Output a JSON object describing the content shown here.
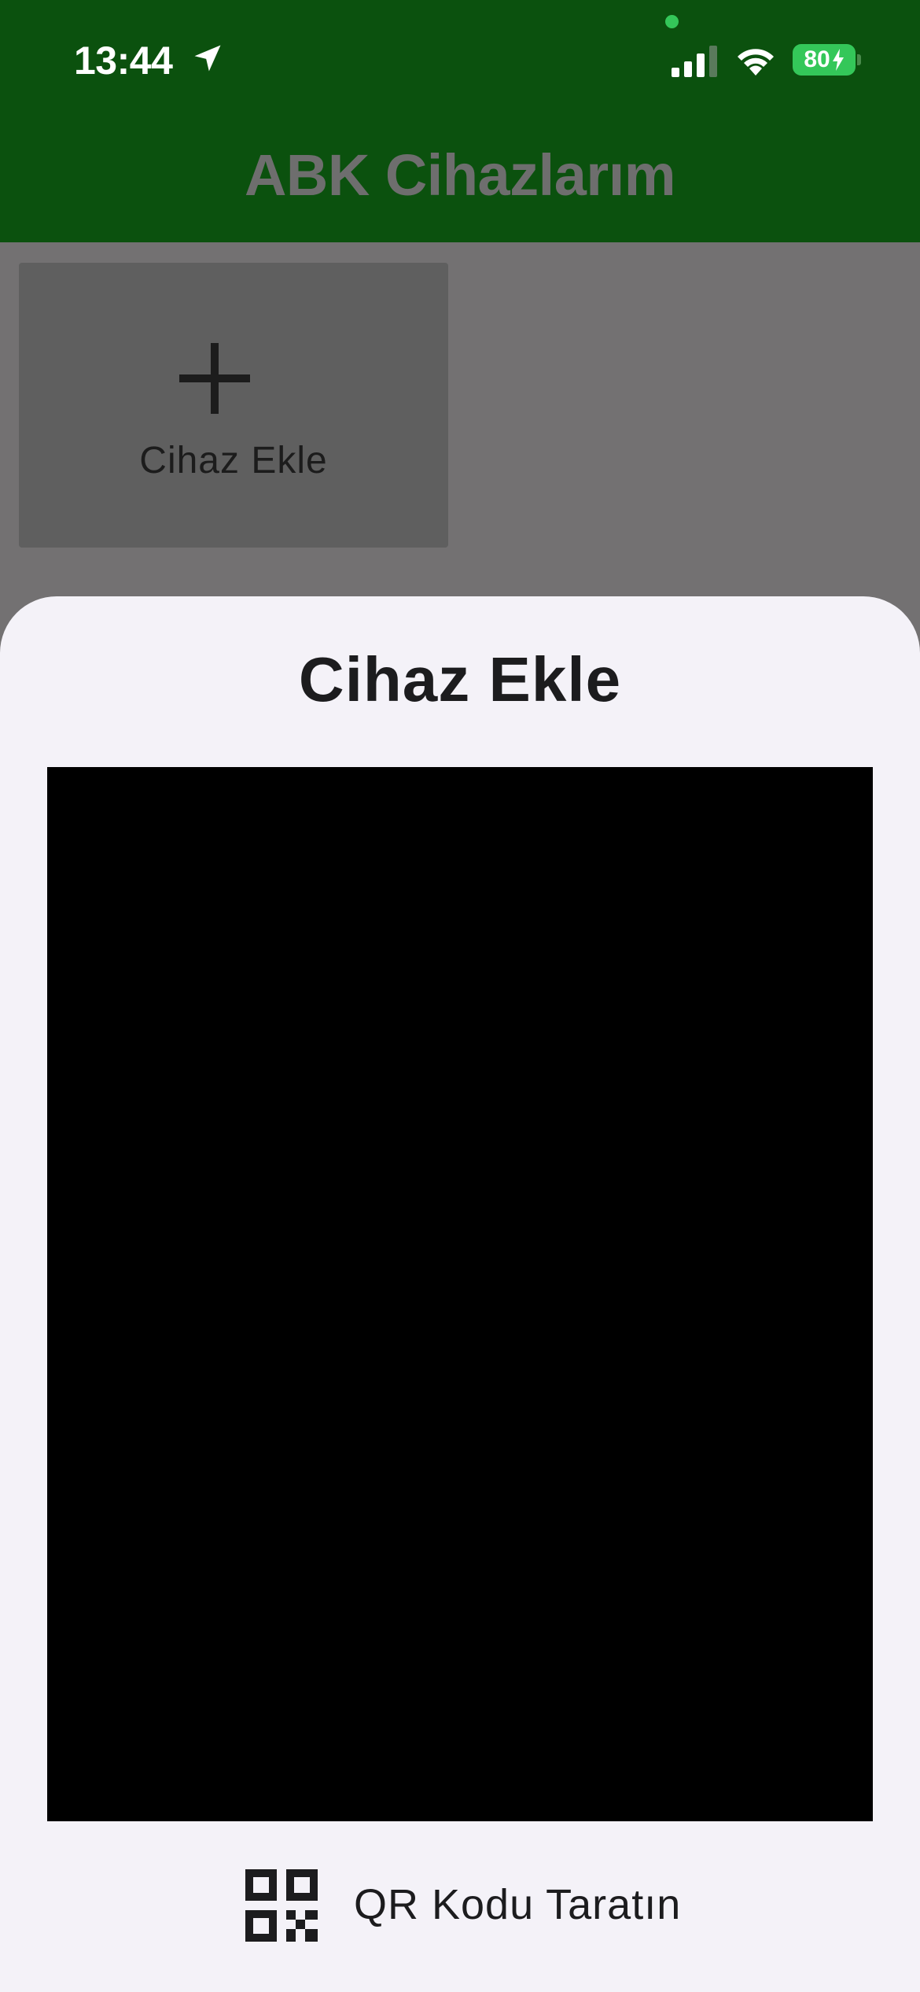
{
  "status_bar": {
    "time": "13:44",
    "battery_level": "80",
    "icons": [
      "location-arrow-icon",
      "cellular-signal-icon",
      "wifi-icon",
      "battery-charging-icon"
    ]
  },
  "header": {
    "title": "ABK Cihazlarım",
    "background_color": "#0b510e"
  },
  "device_grid": {
    "add_tile": {
      "icon": "plus-icon",
      "label": "Cihaz Ekle"
    }
  },
  "sheet": {
    "title": "Cihaz Ekle",
    "scan_button": {
      "icon": "qr-code-icon",
      "label": "QR Kodu Taratın"
    }
  },
  "colors": {
    "accent_green": "#34c759",
    "overlay_gray": "#737172",
    "sheet_background": "#f4f2f8"
  }
}
